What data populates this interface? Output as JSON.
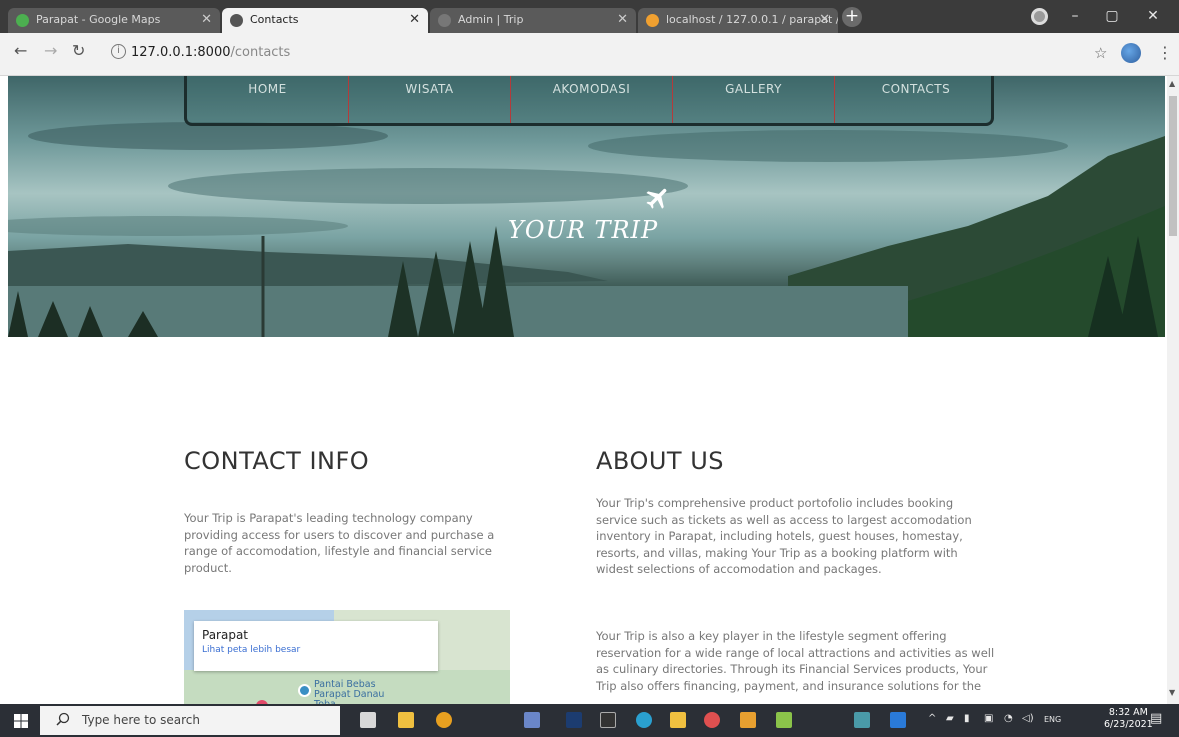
{
  "browser": {
    "tabs": [
      {
        "title": "Parapat - Google Maps",
        "favicon_color": "#4caf50",
        "active": false
      },
      {
        "title": "Contacts",
        "favicon_color": "#555555",
        "active": true
      },
      {
        "title": "Admin | Trip",
        "favicon_color": "#777777",
        "active": false
      },
      {
        "title": "localhost / 127.0.0.1 / parapat / ...",
        "favicon_color": "#f0a030",
        "active": false
      }
    ],
    "new_tab_label": "+",
    "window_controls": {
      "minimize": "–",
      "maximize": "▢",
      "close": "✕"
    },
    "url_host": "127.0.0.1:8000",
    "url_path": "/contacts"
  },
  "site": {
    "nav": [
      "HOME",
      "WISATA",
      "AKOMODASI",
      "GALLERY",
      "CONTACTS"
    ],
    "brand": "YOUR TRIP"
  },
  "contact": {
    "heading": "CONTACT INFO",
    "text": "Your Trip is Parapat's leading technology company providing access for users to discover and purchase a range of accomodation, lifestyle and financial service product.",
    "map": {
      "place": "Parapat",
      "link": "Lihat peta lebih besar",
      "poi": "Pantai Bebas Parapat Danau Toba"
    }
  },
  "about": {
    "heading": "ABOUT US",
    "text1": "Your Trip's comprehensive product portofolio includes booking service such as tickets as well as access to largest accomodation inventory in Parapat, including hotels, guest houses, homestay, resorts, and villas, making Your Trip as a booking platform with widest selections of accomodation and packages.",
    "text2": "Your Trip is also a key player in the lifestyle segment offering reservation for a wide range of local attractions and activities as well as culinary directories. Through its Financial Services products, Your Trip also offers financing, payment, and insurance solutions for the"
  },
  "taskbar": {
    "search_placeholder": "Type here to search",
    "lang": "ENG",
    "time": "8:32 AM",
    "date": "6/23/2021"
  }
}
